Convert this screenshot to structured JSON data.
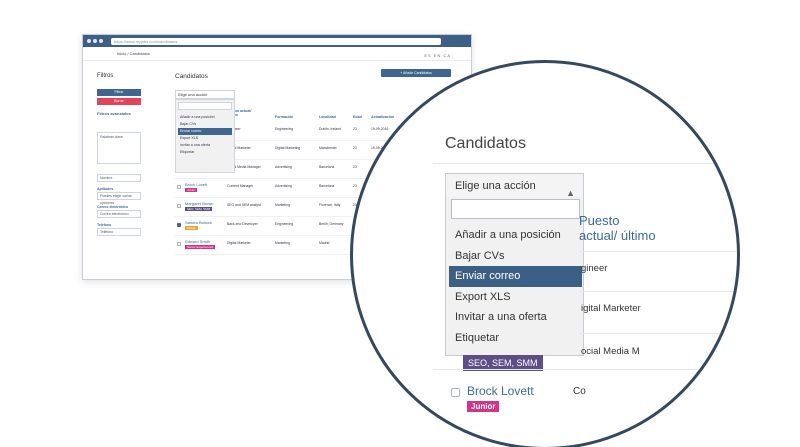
{
  "browser": {
    "url": "https://www.myjobs.com/candidatos",
    "breadcrumb": "Inicio / Candidatos",
    "top_right": "ES  EN  CA"
  },
  "sidebar": {
    "title": "Filtros",
    "filter_button": "Filtrar",
    "clear_button": "Borrar",
    "advanced_link": "Filtros avanzados",
    "keywords_placeholder": "Palabras clave",
    "name_placeholder": "Nombre",
    "skills_label": "Aptitudes",
    "skills_placeholder": "Puedes elegir varias opciones",
    "email_label": "Correo electrónico",
    "email_placeholder": "Correo electrónico",
    "phone_label": "Teléfono",
    "phone_placeholder": "Teléfono"
  },
  "main": {
    "title": "Candidatos",
    "add_button": "+ Añadir Candidatos",
    "select_label": "Elige una acción",
    "actions": [
      "Añadir a una posición",
      "Bajar CVs",
      "Enviar correo",
      "Export XLS",
      "Invitar a una oferta",
      "Etiquetar"
    ],
    "active_action_index": 2,
    "columns": [
      "Puesto actual/ último",
      "Formación",
      "Localidad",
      "Edad",
      "Actualización"
    ],
    "rows": [
      {
        "name": "",
        "badge": "",
        "job": "Engineer",
        "education": "Engineering",
        "city": "Dublin, Ireland",
        "age": "23",
        "updated": "19-09-2016",
        "checked": false
      },
      {
        "name": "",
        "badge": "",
        "job": "Digital Marketer",
        "education": "Digital Marketing",
        "city": "Manchester",
        "age": "23",
        "updated": "19-09-2016",
        "checked": false
      },
      {
        "name": "",
        "badge": "SEO, SEM, SMM",
        "job": "Social Media Manager",
        "education": "Advertising",
        "city": "Barcelona",
        "age": "23",
        "updated": "19-09-2016",
        "checked": false
      },
      {
        "name": "Brock Lovett",
        "badge": "Junior",
        "job": "Content Manager",
        "education": "Advertising",
        "city": "Barcelona",
        "age": "23",
        "updated": "19-09-2016",
        "checked": false
      },
      {
        "name": "Margaret Brown",
        "badge": "SEO, SEM, SMM",
        "job": "SEO and SEM analyst",
        "education": "Marketing",
        "city": "Florence, Italy",
        "age": "23",
        "updated": "19-09-2016",
        "checked": false
      },
      {
        "name": "Sandra Bullock",
        "badge": "Mobile",
        "job": "Back-end Developer",
        "education": "Engineering",
        "city": "Berlin, Germany",
        "age": "23",
        "updated": "19-09-2016",
        "checked": true
      },
      {
        "name": "Edward Smith",
        "badge": "Senior Experienced",
        "job": "Digital Marketer",
        "education": "Marketing",
        "city": "Madrid",
        "age": "23",
        "updated": "19-09-2016",
        "checked": false
      }
    ]
  },
  "zoom": {
    "title": "Candidatos",
    "select_label": "Elige una acción",
    "column_head": "Puesto actual/ último",
    "row_jobs": [
      "gineer",
      "igital Marketer",
      "ocial Media M"
    ],
    "badge_seo": "SEO, SEM, SMM",
    "name": "Brock Lovett",
    "badge_junior": "Junior",
    "cut_text": "Co"
  },
  "colors": {
    "primary": "#3c5f85",
    "danger": "#e4435a",
    "link": "#3b6aa0",
    "badge_purple": "#5b4f86",
    "badge_pink": "#d63384"
  }
}
